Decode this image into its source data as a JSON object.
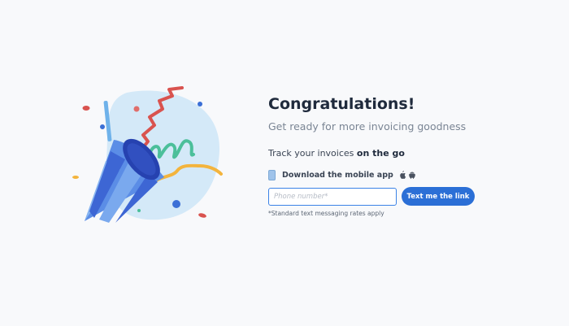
{
  "illustration": {
    "icon": "party-popper-icon",
    "colors": {
      "blob": "#cfe6f7",
      "cone_dark": "#2f4fc4",
      "cone_light": "#6fa3ec",
      "streamer_red": "#d9534f",
      "streamer_green": "#4bbf9a",
      "streamer_yellow": "#f3b43d",
      "dot_blue": "#3b6fd6"
    }
  },
  "header": {
    "title": "Congratulations!",
    "subtitle": "Get ready for more invoicing goodness"
  },
  "track": {
    "prefix": "Track your invoices ",
    "emphasis": "on the go"
  },
  "download": {
    "label": "Download the mobile app",
    "icons": [
      "mobile-phone-icon",
      "apple-icon",
      "android-icon"
    ]
  },
  "form": {
    "phone_placeholder": "Phone number*",
    "phone_value": "",
    "submit_label": "Text me the link",
    "disclaimer": "*Standard text messaging rates apply"
  },
  "colors": {
    "accent": "#2b6fd6",
    "title": "#1f2a3c",
    "subtitle": "#7a8594",
    "background": "#f8f9fb"
  }
}
